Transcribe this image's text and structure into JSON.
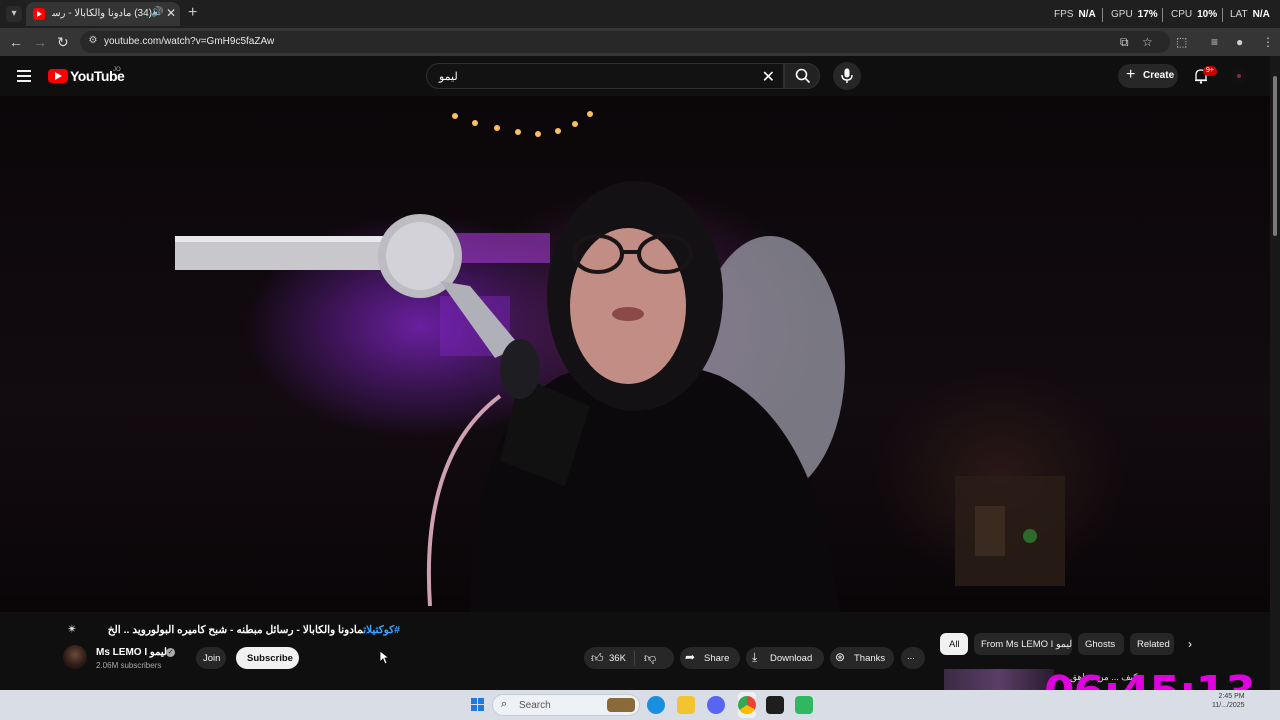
{
  "browser": {
    "tab_title": "(34) مادونا والكابالا - رسائل ...",
    "new_tab_glyph": "+",
    "url": "youtube.com/watch?v=GmH9c5faZAw",
    "perf": {
      "fps_label": "FPS",
      "fps_value": "N/A",
      "gpu_label": "GPU",
      "gpu_value": "17%",
      "cpu_label": "CPU",
      "cpu_value": "10%",
      "lat_label": "LAT",
      "lat_value": "N/A"
    }
  },
  "youtube": {
    "logo_text": "YouTube",
    "region": "JO",
    "search_query": "ليمو",
    "create_label": "Create",
    "notifications_badge": "9+"
  },
  "video": {
    "title_hashtag": "#كوكتيلات",
    "title_text": "مادونا والكابالا - رسائل مبطنه - شبح كاميره البولورويد .. الخ",
    "channel_name": "Ms LEMO I ليمو",
    "subscribers": "2.06M subscribers",
    "join_label": "Join",
    "subscribe_label": "Subscribe",
    "likes": "36K",
    "share_label": "Share",
    "download_label": "Download",
    "thanks_label": "Thanks",
    "more_label": "..."
  },
  "sidebar": {
    "chips": [
      "All",
      "From Ms LEMO I ليمو",
      "Ghosts",
      "Related"
    ],
    "preview_text": "كيف ... من مراهق ..."
  },
  "overlay_clock": "06:45:13",
  "taskbar": {
    "search_label": "Search",
    "tray_time": "2:45 PM",
    "tray_date": "11/.../2025"
  },
  "colors": {
    "background": "#0f0f0f",
    "brand_red": "#ff0000",
    "link_blue": "#3ea6ff",
    "clock_magenta": "#e000e0"
  },
  "icons": [
    "tab-search-icon",
    "youtube-favicon",
    "speaker-icon",
    "close-icon",
    "back-icon",
    "forward-icon",
    "reload-icon",
    "site-info-icon",
    "install-icon",
    "star-icon",
    "extensions-icon",
    "media-icon",
    "profile-icon",
    "menu-icon",
    "search-icon",
    "mic-icon",
    "bell-icon",
    "like-icon",
    "dislike-icon",
    "share-icon",
    "download-icon",
    "thanks-icon",
    "chevron-right-icon",
    "windows-start-icon"
  ]
}
